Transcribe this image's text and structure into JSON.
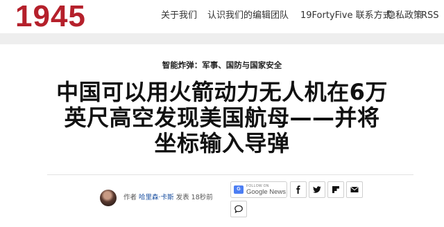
{
  "site": {
    "logo": "1945",
    "brand_color": "#b5202b"
  },
  "nav": {
    "items": [
      {
        "label": "关于我们"
      },
      {
        "label": "认识我们的编辑团队"
      },
      {
        "label": "19FortyFive 联系方式"
      },
      {
        "label": "隐私政策"
      },
      {
        "label": "RSS"
      }
    ]
  },
  "article": {
    "category": "智能炸弹：军事、国防与国家安全",
    "headline_lines": [
      "中国可以用火箭动力无人机在6万",
      "英尺高空发现美国航母——并将",
      "坐标输入导弹"
    ],
    "byline": {
      "prefix": "作者",
      "author": "哈里森·卡斯",
      "verb": "发表",
      "time": "18秒前"
    }
  },
  "share": {
    "google_news_follow": "FOLLOW ON",
    "google_news_label": "Google News",
    "google_news_icon_text": "G",
    "icons": [
      "facebook-icon",
      "twitter-icon",
      "flipboard-icon",
      "email-icon",
      "comment-icon"
    ]
  }
}
